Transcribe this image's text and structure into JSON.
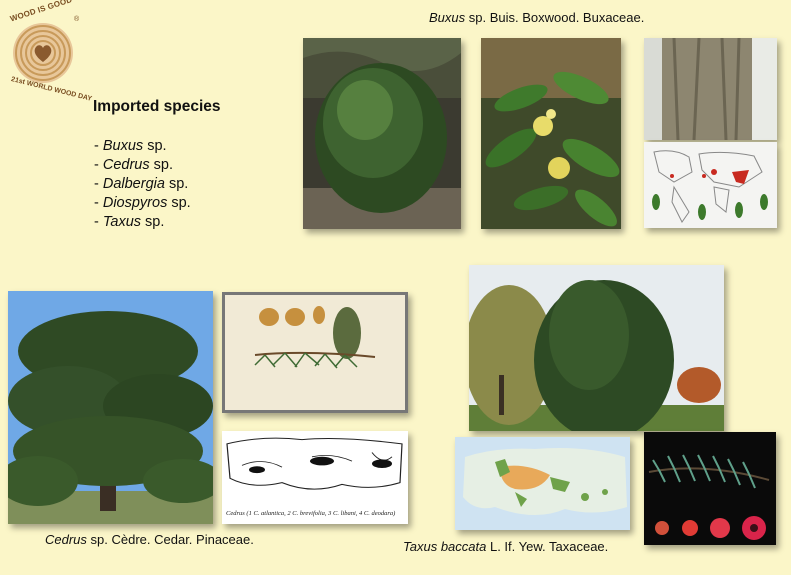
{
  "logo": {
    "top_text": "WOOD IS GOOD",
    "side_text": "21st WORLD WOOD DAY",
    "registered": "®",
    "colors": {
      "ring": "#c89a5a",
      "ring_light": "#e8c79a",
      "heart": "#8a5a2e"
    }
  },
  "heading": "Imported species",
  "species": [
    {
      "prefix": "- ",
      "genus": "Buxus",
      "suffix": " sp."
    },
    {
      "prefix": "- ",
      "genus": "Cedrus",
      "suffix": " sp."
    },
    {
      "prefix": "- ",
      "genus": "Dalbergia",
      "suffix": " sp."
    },
    {
      "prefix": "- ",
      "genus": "Diospyros",
      "suffix": " sp."
    },
    {
      "prefix": "- ",
      "genus": "Taxus",
      "suffix": " sp."
    }
  ],
  "captions": {
    "buxus": {
      "italic": "Buxus",
      "rest": " sp. Buis. Boxwood. Buxaceae."
    },
    "cedrus": {
      "italic": "Cedrus",
      "rest": " sp. Cèdre. Cedar. Pinaceae."
    },
    "taxus": {
      "italic": "Taxus baccata",
      "rest": " L. If. Yew. Taxaceae."
    }
  },
  "cedrus_map_caption": "Cedrus (1 C. atlantica, 2 C. brevifolia, 3 C. libani, 4 C. deodara)",
  "colors": {
    "slide_bg": "#fbf6c8",
    "foliage_dark": "#2f4a24",
    "foliage": "#4f7a34",
    "sky": "#6fa8e6"
  }
}
